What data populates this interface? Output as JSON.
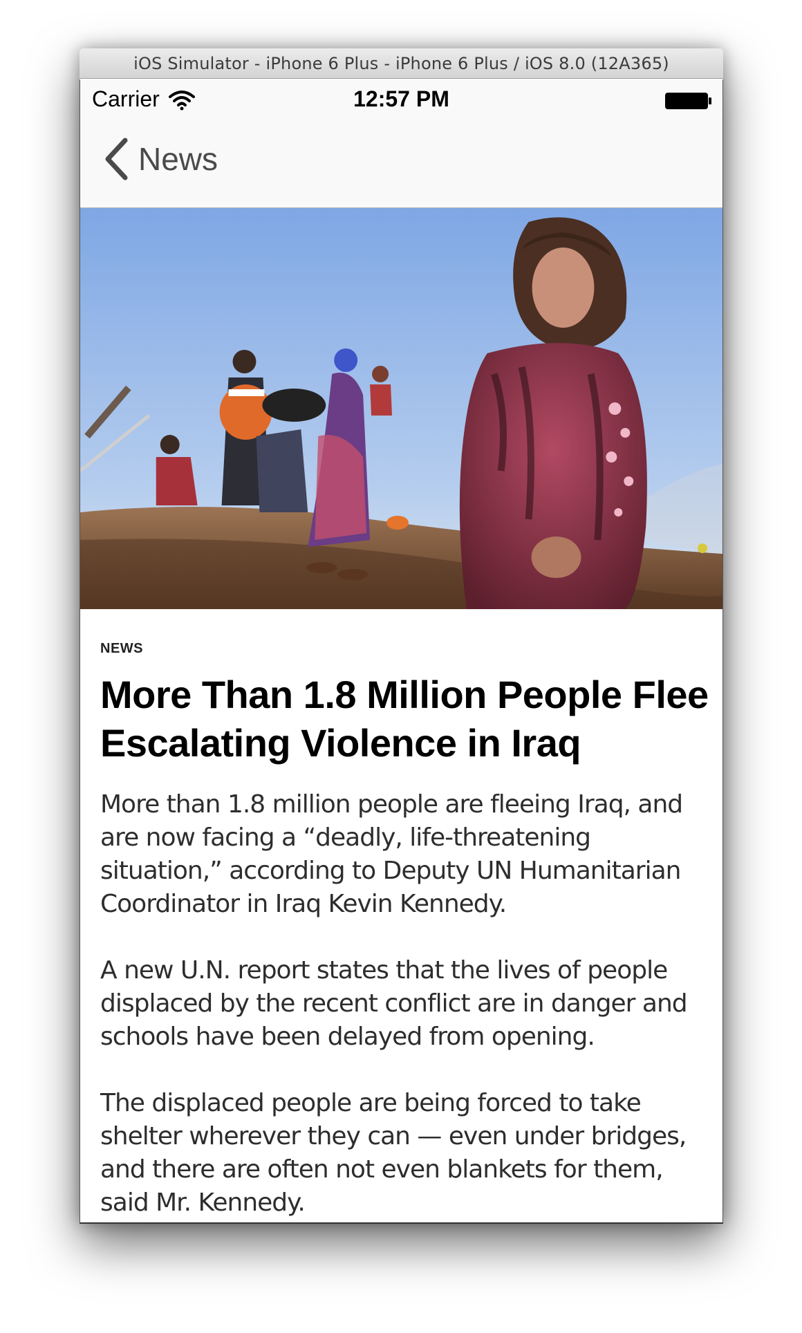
{
  "window": {
    "title": "iOS Simulator - iPhone 6 Plus - iPhone 6 Plus / iOS 8.0 (12A365)"
  },
  "status_bar": {
    "carrier": "Carrier",
    "time": "12:57 PM"
  },
  "nav": {
    "back_label": "News"
  },
  "article": {
    "category": "NEWS",
    "headline": "More Than 1.8 Million People Flee Escalating Violence in Iraq",
    "paragraphs": [
      "More than 1.8 million people are fleeing Iraq, and are now facing a “deadly, life-threatening situation,” according to Deputy UN Humanitarian Coordinator in Iraq Kevin Kennedy.",
      "A new U.N. report states that the lives of people displaced by the recent conflict are in danger and schools have been delayed from opening.",
      "The displaced people are being forced to take shelter wherever they can — even under bridges, and there are often not even blankets for them, said Mr. Kennedy."
    ]
  },
  "icons": {
    "wifi": "wifi-icon",
    "battery": "battery-icon",
    "back": "chevron-left-icon"
  },
  "colors": {
    "nav_background": "#f9f9f9",
    "back_tint": "#4a4a4a",
    "body_text": "#2d2d2d",
    "headline": "#000000"
  }
}
